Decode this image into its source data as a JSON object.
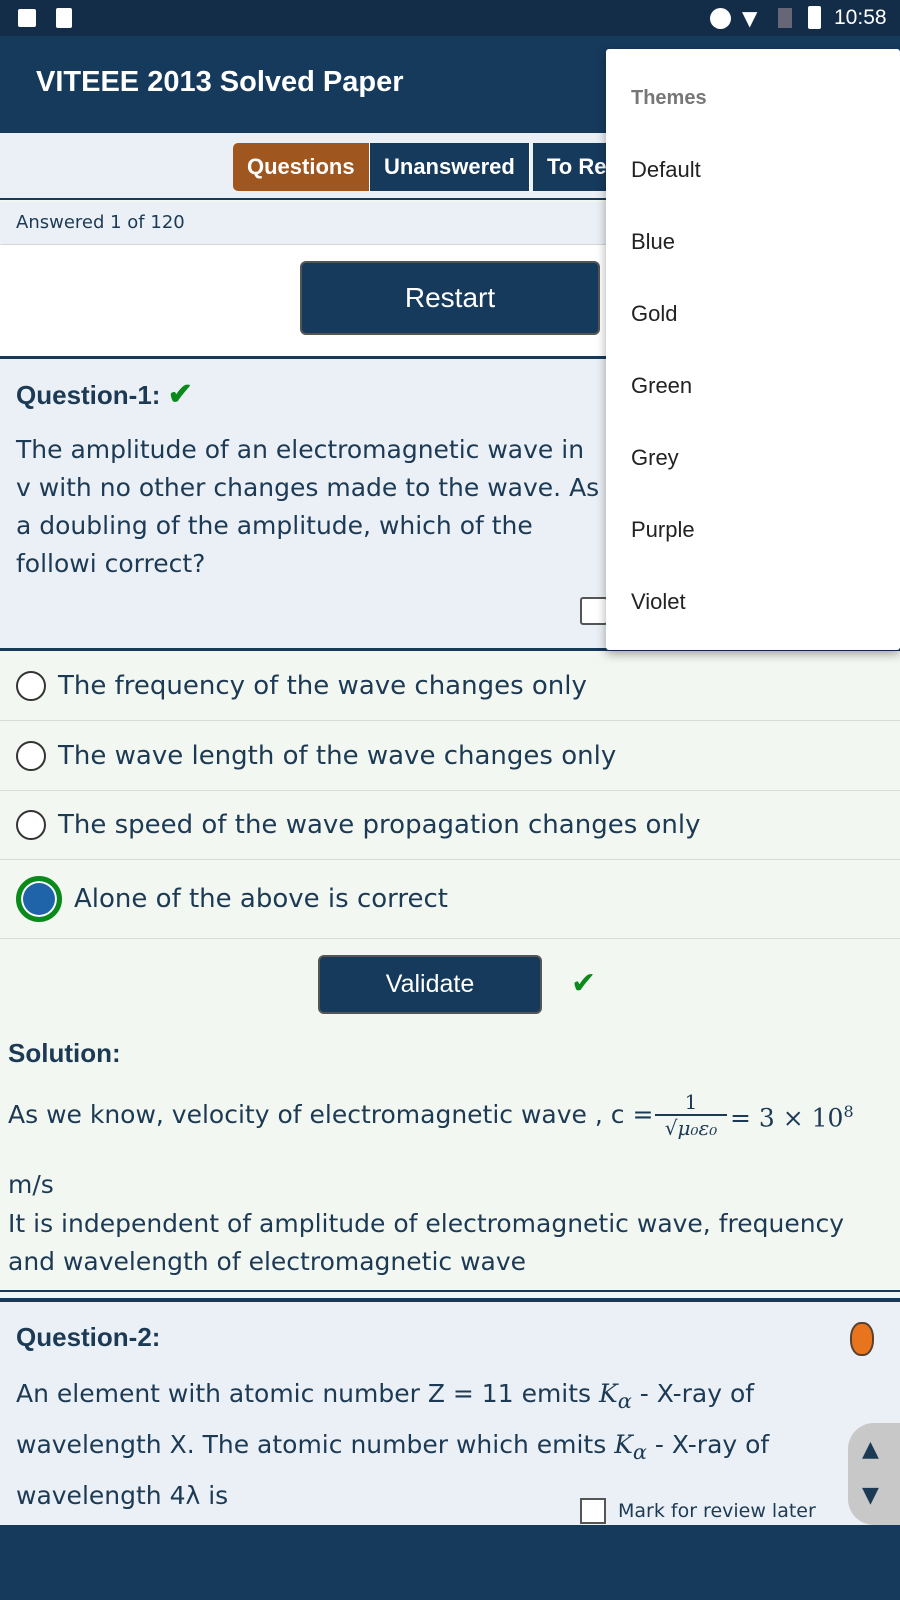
{
  "status": {
    "time": "10:58"
  },
  "app": {
    "title": "VITEEE 2013 Solved Paper"
  },
  "tabs": [
    {
      "label": "Questions",
      "active": true
    },
    {
      "label": "Unanswered"
    },
    {
      "label": "To Re"
    }
  ],
  "progress": {
    "text": "Answered 1 of 120"
  },
  "restart_label": "Restart",
  "q1": {
    "heading": "Question-1:",
    "check": "✔",
    "text": "The amplitude of an electromagnetic wave in v with no other changes made to the wave. As a doubling of the amplitude, which of the followi correct?",
    "options": [
      "The frequency of the wave changes only",
      "The wave length of the wave changes only",
      "The speed of the wave propagation changes only",
      "Alone of the above is correct"
    ],
    "selected": 3,
    "validate_label": "Validate",
    "solution_heading": "Solution:",
    "solution_line1": "As we know, velocity of electromagnetic wave , c =",
    "frac_num": "1",
    "frac_den": "√μ₀ε₀",
    "solution_eq": "= 3 × 10",
    "solution_exp": "8",
    "solution_unit": "m/s",
    "solution_line2": "It is independent of amplitude of electromagnetic wave, frequency and wavelength of electromagnetic wave"
  },
  "q2": {
    "heading": "Question-2:",
    "text1": "An element with atomic number Z = 11 emits",
    "k": "K",
    "alpha": "α",
    "text2": "- X-ray of",
    "text3": "wavelength X. The atomic number which emits",
    "text4": "- X-ray of",
    "text5": "wavelength 4λ is",
    "mark_label": "Mark for review later"
  },
  "menu": {
    "header": "Themes",
    "items": [
      "Default",
      "Blue",
      "Gold",
      "Green",
      "Grey",
      "Purple",
      "Violet"
    ]
  },
  "colors": {
    "primary": "#163a5c",
    "accent": "#a0561f",
    "check": "#0a8a1a"
  }
}
